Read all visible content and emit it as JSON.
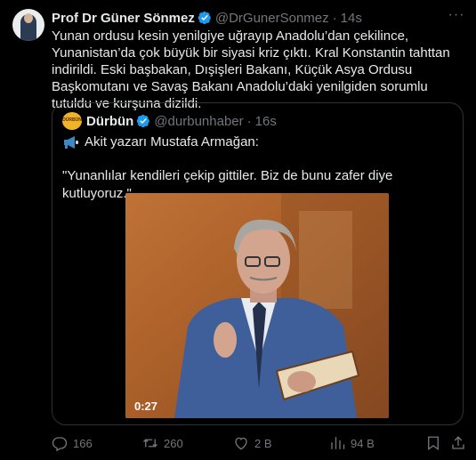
{
  "tweet": {
    "author_name": "Prof Dr Güner Sönmez",
    "handle": "@DrGunerSonmez",
    "separator": "·",
    "time": "14s",
    "more": "···",
    "text": "Yunan ordusu kesin yenilgiye uğrayıp Anadolu’dan çekilince, Yunanistan’da çok büyük bir siyasi kriz çıktı. Kral Konstantin tahttan indirildi. Eski başbakan, Dışişleri Bakanı, Küçük Asya Ordusu Başkomutanı ve Savaş Bakanı Anadolu’daki yenilgiden sorumlu tutuldu ve kurşuna dizildi."
  },
  "quote": {
    "avatar_text": "DÜRBÜN",
    "author_name": "Dürbün",
    "handle": "@durbunhaber",
    "separator": "·",
    "time": "16s",
    "line1": "Akit yazarı Mustafa Armağan:",
    "line2": "\"Yunanlılar kendileri çekip gittiler. Biz de bunu zafer diye kutluyoruz.\"",
    "video_duration": "0:27"
  },
  "actions": {
    "replies": "166",
    "retweets": "260",
    "likes": "2 B",
    "views": "94 B"
  },
  "colors": {
    "background": "#000000",
    "text": "#e7e9ea",
    "muted": "#71767b",
    "verified": "#1d9bf0",
    "border": "#2f3336"
  },
  "icons": [
    "verified-badge-icon",
    "megaphone-icon",
    "reply-icon",
    "retweet-icon",
    "like-icon",
    "views-icon",
    "bookmark-icon",
    "share-icon"
  ]
}
